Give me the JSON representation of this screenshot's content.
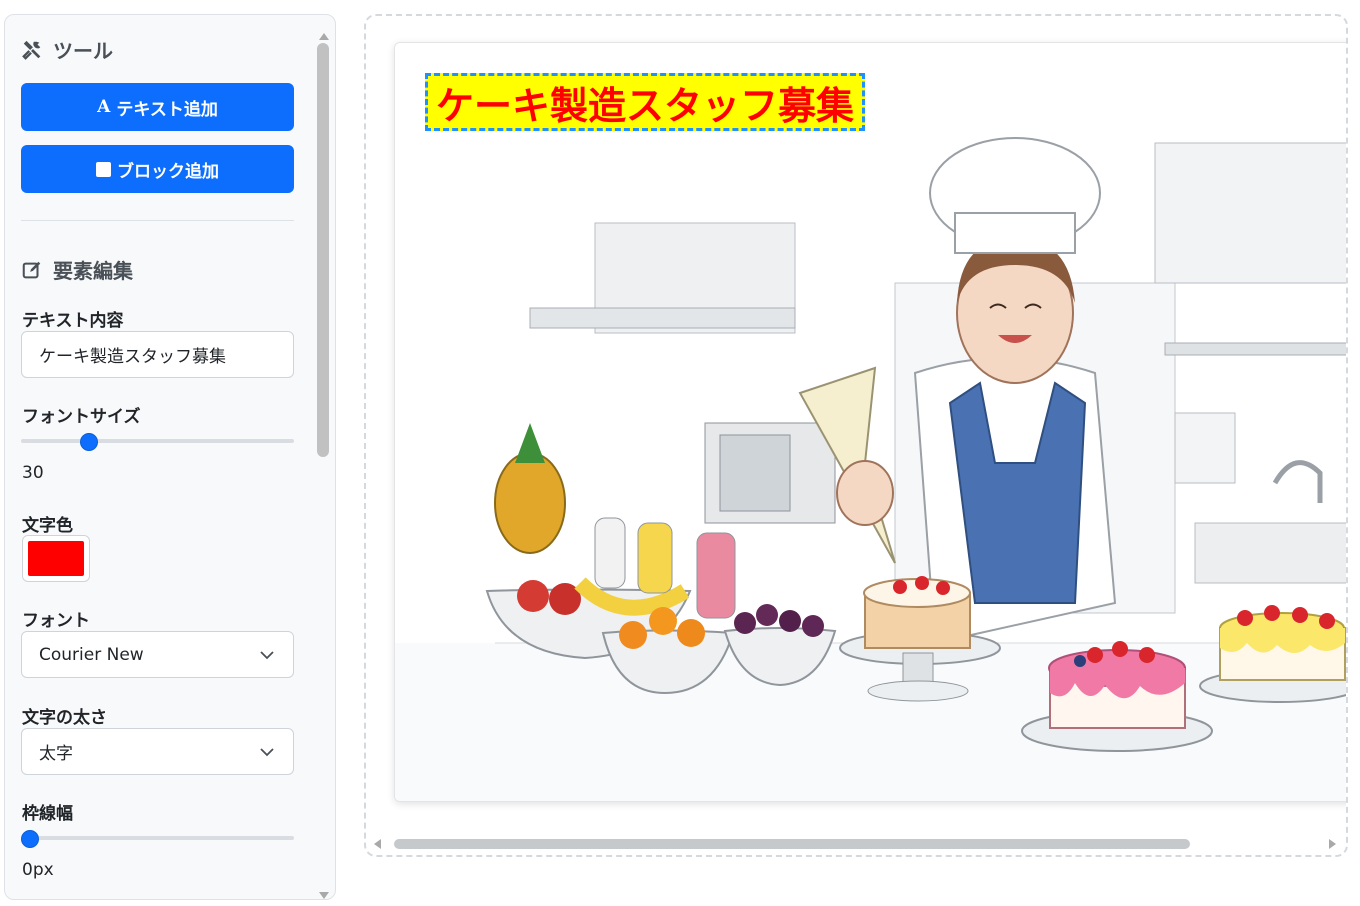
{
  "tools": {
    "title": "ツール",
    "add_text_label": "テキスト追加",
    "add_block_label": "ブロック追加"
  },
  "edit": {
    "title": "要素編集",
    "text_content_label": "テキスト内容",
    "text_content_value": "ケーキ製造スタッフ募集",
    "font_size_label": "フォントサイズ",
    "font_size_value": "30",
    "font_size_fraction": 0.23,
    "text_color_label": "文字色",
    "text_color": "#ff0000",
    "font_label": "フォント",
    "font_value": "Courier New",
    "weight_label": "文字の太さ",
    "weight_value": "太字",
    "border_width_label": "枠線幅",
    "border_width_value": "0px",
    "border_width_fraction": 0.0
  },
  "canvas": {
    "text_element": "ケーキ製造スタッフ募集",
    "text_bg_color": "#ffff00",
    "selection_color": "#1e90ff"
  },
  "colors": {
    "accent": "#0d6efd"
  }
}
